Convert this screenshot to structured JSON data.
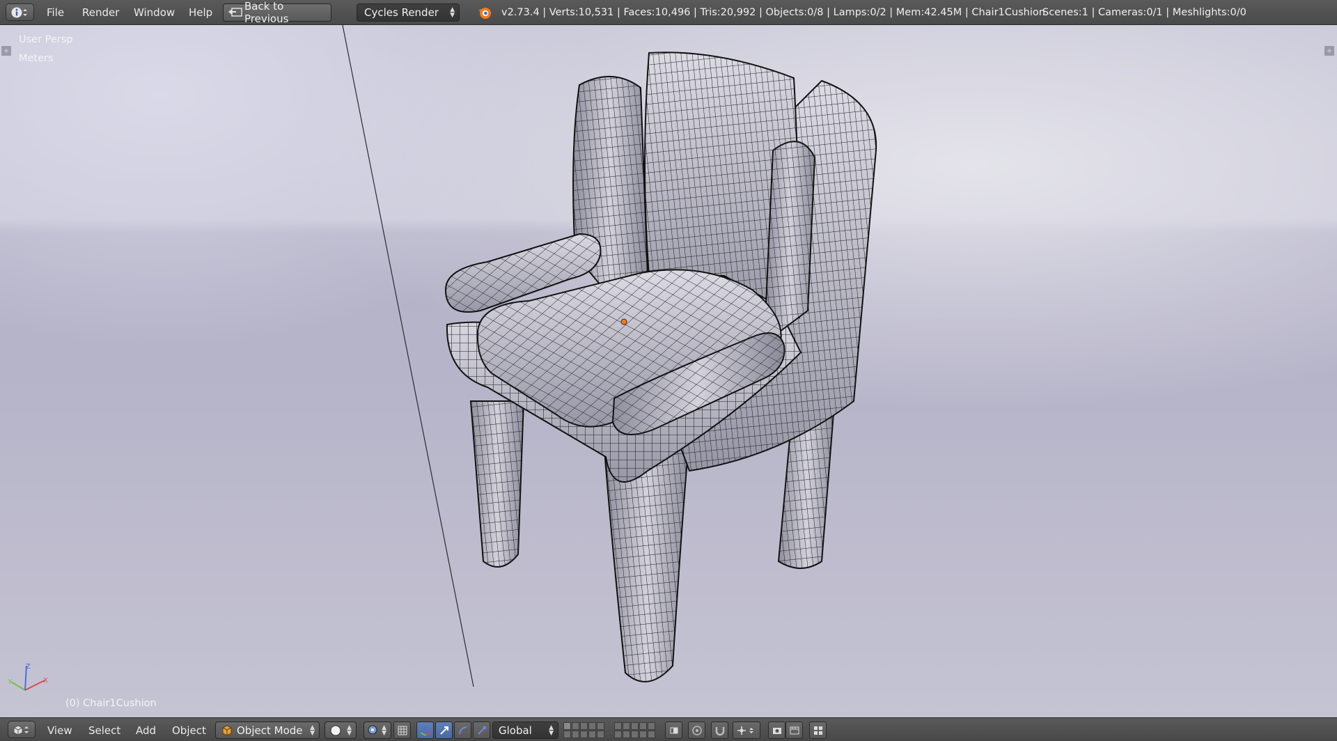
{
  "top_header": {
    "editor_type_icon": "info-icon",
    "menus": [
      "File",
      "Render",
      "Window",
      "Help"
    ],
    "back_button_label": "Back to Previous",
    "back_button_icon": "back-to-previous-icon",
    "render_engine": "Cycles Render",
    "blender_logo_icon": "blender-logo-icon",
    "stats": "v2.73.4 | Verts:10,531 | Faces:10,496 | Tris:20,992 | Objects:0/8 | Lamps:0/2 | Mem:42.45M | Chair1Cushion",
    "scene_stats": "Scenes:1 | Cameras:0/1 | Meshlights:0/0"
  },
  "viewport": {
    "view_name": "User Persp",
    "units": "Meters",
    "active_object": "(0) Chair1Cushion",
    "axis_labels": {
      "x": "X",
      "y": "Y",
      "z": "Z"
    },
    "colors": {
      "axis_x": "#d94c4c",
      "axis_y": "#6fbf3f",
      "axis_z": "#4a6fd9",
      "origin": "#f07c1a",
      "mesh_fill": "#b4b3c2",
      "wire": "#1a1a1a"
    }
  },
  "bottom_header": {
    "editor_type_icon": "3d-view-icon",
    "menus": [
      "View",
      "Select",
      "Add",
      "Object"
    ],
    "mode": "Object Mode",
    "mode_icon": "object-mode-cube-icon",
    "shading_icon": "solid-shading-icon",
    "pivot_icon": "pivot-point-icon",
    "orientation": "Global",
    "accent": "#5a7ab6"
  }
}
